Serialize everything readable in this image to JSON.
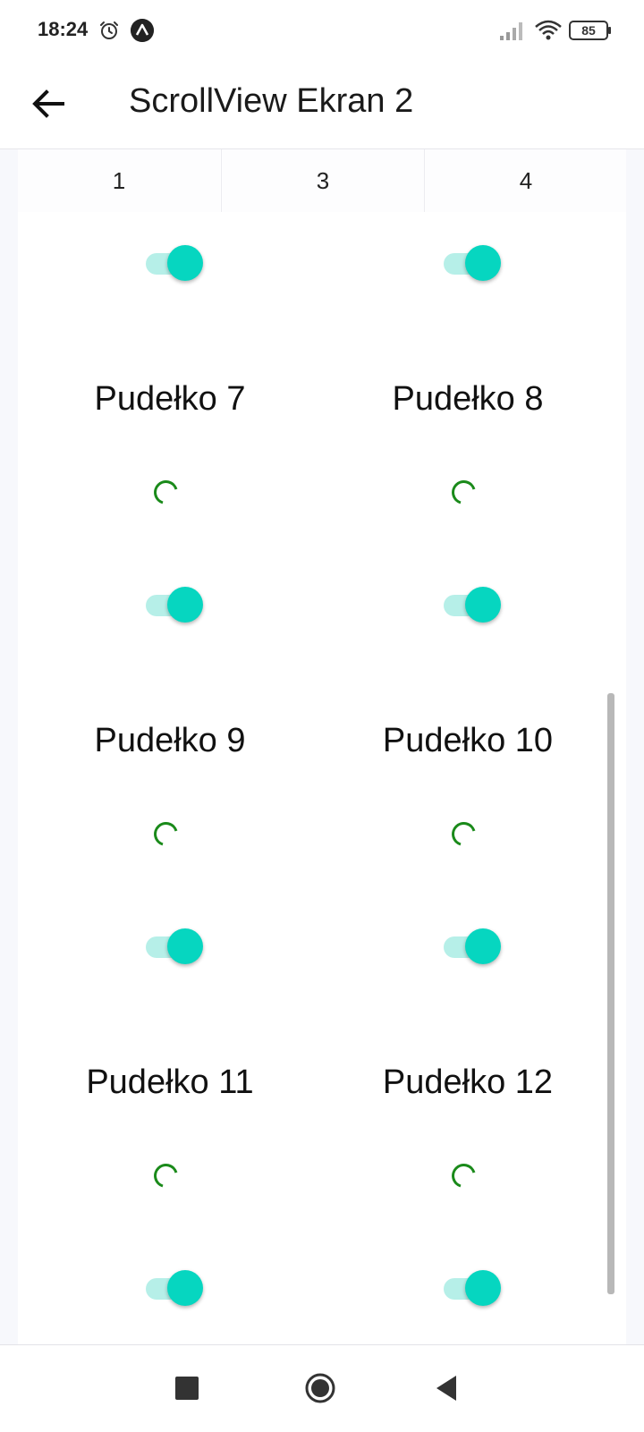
{
  "status_bar": {
    "time": "18:24",
    "battery_level": "85"
  },
  "app_bar": {
    "title": "ScrollView Ekran 2"
  },
  "tabs": [
    {
      "label": "1"
    },
    {
      "label": "3"
    },
    {
      "label": "4"
    }
  ],
  "boxes": [
    {
      "label": "Pudełko 7",
      "toggle_on": true
    },
    {
      "label": "Pudełko 8",
      "toggle_on": true
    },
    {
      "label": "Pudełko 9",
      "toggle_on": true
    },
    {
      "label": "Pudełko 10",
      "toggle_on": true
    },
    {
      "label": "Pudełko 11",
      "toggle_on": true
    },
    {
      "label": "Pudełko 12",
      "toggle_on": true
    }
  ],
  "colors": {
    "toggle_thumb": "#06d6c0",
    "toggle_track": "#b6efe8",
    "spinner": "#1a8a1a"
  }
}
